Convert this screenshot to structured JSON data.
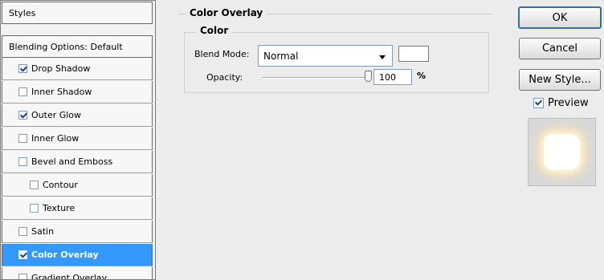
{
  "styles_panel": {
    "header_label": "Styles",
    "blending_options_label": "Blending Options: Default",
    "items": [
      {
        "label": "Drop Shadow",
        "checked": true,
        "indent": false,
        "selected": false
      },
      {
        "label": "Inner Shadow",
        "checked": false,
        "indent": false,
        "selected": false
      },
      {
        "label": "Outer Glow",
        "checked": true,
        "indent": false,
        "selected": false
      },
      {
        "label": "Inner Glow",
        "checked": false,
        "indent": false,
        "selected": false
      },
      {
        "label": "Bevel and Emboss",
        "checked": false,
        "indent": false,
        "selected": false
      },
      {
        "label": "Contour",
        "checked": false,
        "indent": true,
        "selected": false
      },
      {
        "label": "Texture",
        "checked": false,
        "indent": true,
        "selected": false
      },
      {
        "label": "Satin",
        "checked": false,
        "indent": false,
        "selected": false
      },
      {
        "label": "Color Overlay",
        "checked": true,
        "indent": false,
        "selected": true
      },
      {
        "label": "Gradient Overlay",
        "checked": false,
        "indent": false,
        "selected": false
      }
    ]
  },
  "color_overlay": {
    "title": "Color Overlay",
    "color_group_title": "Color",
    "blend_mode_label": "Blend Mode:",
    "blend_mode_value": "Normal",
    "swatch_color": "#ffffff",
    "opacity_label": "Opacity:",
    "opacity_value": "100",
    "opacity_unit": "%",
    "opacity_fraction": 1.0
  },
  "buttons": {
    "ok": "OK",
    "cancel": "Cancel",
    "new_style": "New Style..."
  },
  "preview": {
    "label": "Preview",
    "checked": true
  },
  "colors": {
    "selection": "#3399ff",
    "dialog_bg": "#ececec"
  }
}
